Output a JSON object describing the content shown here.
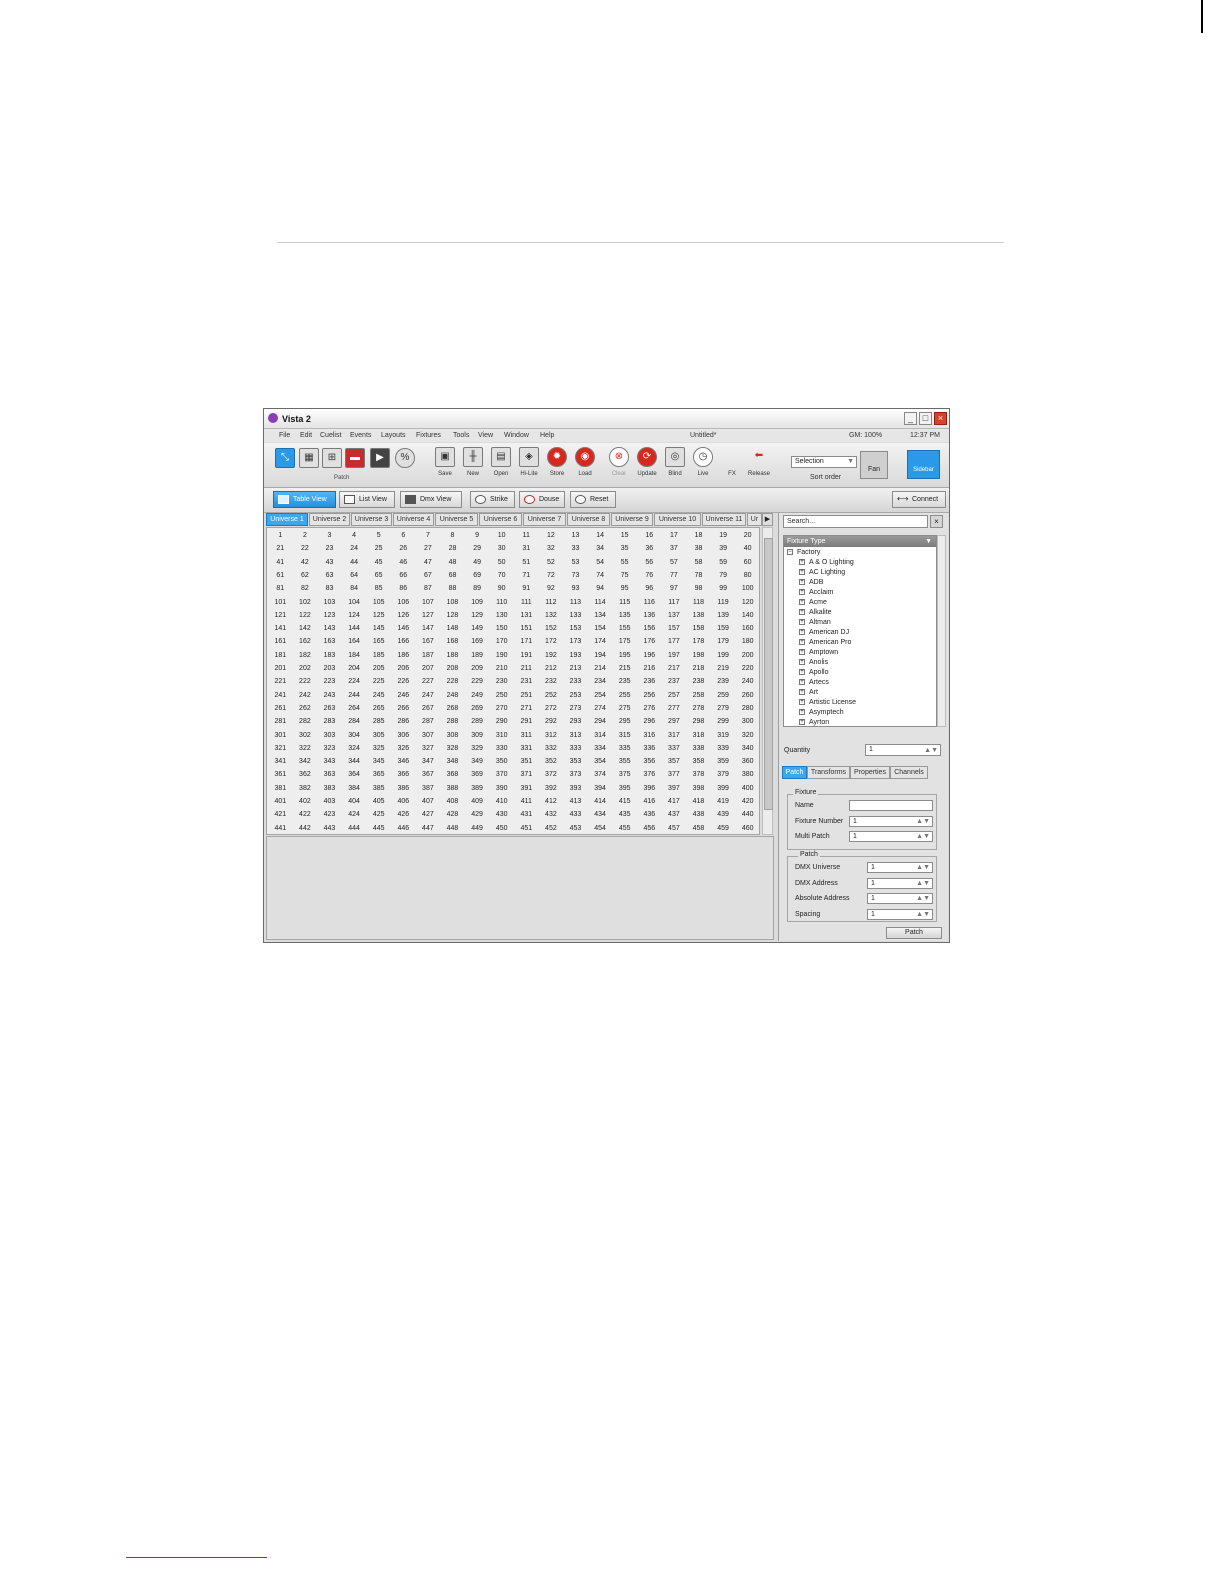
{
  "window": {
    "title": "Vista 2"
  },
  "menu": {
    "items": [
      "File",
      "Edit",
      "Cuelist",
      "Events",
      "Layouts",
      "Fixtures",
      "Tools",
      "View",
      "Window",
      "Help"
    ],
    "document": "Untitled*",
    "grand_master": "GM: 100%",
    "clock": "12:37 PM"
  },
  "toolbar": {
    "patch_caption": "Patch",
    "buttons": [
      {
        "label": "Save",
        "icon": "save-icon"
      },
      {
        "label": "New",
        "icon": "faders-icon"
      },
      {
        "label": "Open",
        "icon": "open-icon"
      },
      {
        "label": "Hi-Lite",
        "icon": "hilite-icon"
      },
      {
        "label": "Store",
        "icon": "store-icon"
      },
      {
        "label": "Load",
        "icon": "load-icon"
      },
      {
        "label": "Clear",
        "icon": "clear-icon"
      },
      {
        "label": "Update",
        "icon": "update-icon"
      },
      {
        "label": "Blind",
        "icon": "blind-icon"
      },
      {
        "label": "Live",
        "icon": "clock-icon"
      },
      {
        "label": "FX",
        "icon": "fx-icon"
      },
      {
        "label": "Release",
        "icon": "release-icon"
      }
    ],
    "selection_value": "Selection",
    "sort_order": "Sort order",
    "fan": "Fan",
    "sidebar": "Sidebar"
  },
  "viewbar": {
    "table_view": "Table View",
    "list_view": "List View",
    "dmx_view": "Dmx View",
    "strike": "Strike",
    "douse": "Douse",
    "reset": "Reset",
    "connect": "Connect"
  },
  "universe_tabs": [
    "Universe 1",
    "Universe 2",
    "Universe 3",
    "Universe 4",
    "Universe 5",
    "Universe 6",
    "Universe 7",
    "Universe 8",
    "Universe 9",
    "Universe 10",
    "Universe 11",
    "Ur"
  ],
  "grid": {
    "start": 1,
    "end": 460,
    "columns": 20
  },
  "sidebar": {
    "search_placeholder": "Search...",
    "tree_header": "Fixture Type",
    "tree_root": "Factory",
    "tree_items": [
      "A & O Lighting",
      "AC Lighting",
      "ADB",
      "Acclaim",
      "Acme",
      "Alkalite",
      "Altman",
      "American DJ",
      "American Pro",
      "Amptown",
      "Anolis",
      "Apollo",
      "Artecs",
      "Art",
      "Artistic License",
      "Asymptech",
      "Ayrton"
    ],
    "quantity_label": "Quantity",
    "quantity_value": "1",
    "tabs": [
      "Patch",
      "Transforms",
      "Properties",
      "Channels"
    ],
    "fixture_group": "Fixture",
    "fixture_fields": [
      {
        "label": "Name",
        "value": ""
      },
      {
        "label": "Fixture Number",
        "value": "1"
      },
      {
        "label": "Multi Patch",
        "value": "1"
      }
    ],
    "patch_group": "Patch",
    "patch_fields": [
      {
        "label": "DMX Universe",
        "value": "1"
      },
      {
        "label": "DMX Address",
        "value": "1"
      },
      {
        "label": "Absolute Address",
        "value": "1"
      },
      {
        "label": "Spacing",
        "value": "1"
      }
    ],
    "patch_button": "Patch"
  },
  "colors": {
    "accent": "#2a9ae8",
    "close": "#d9412d"
  }
}
